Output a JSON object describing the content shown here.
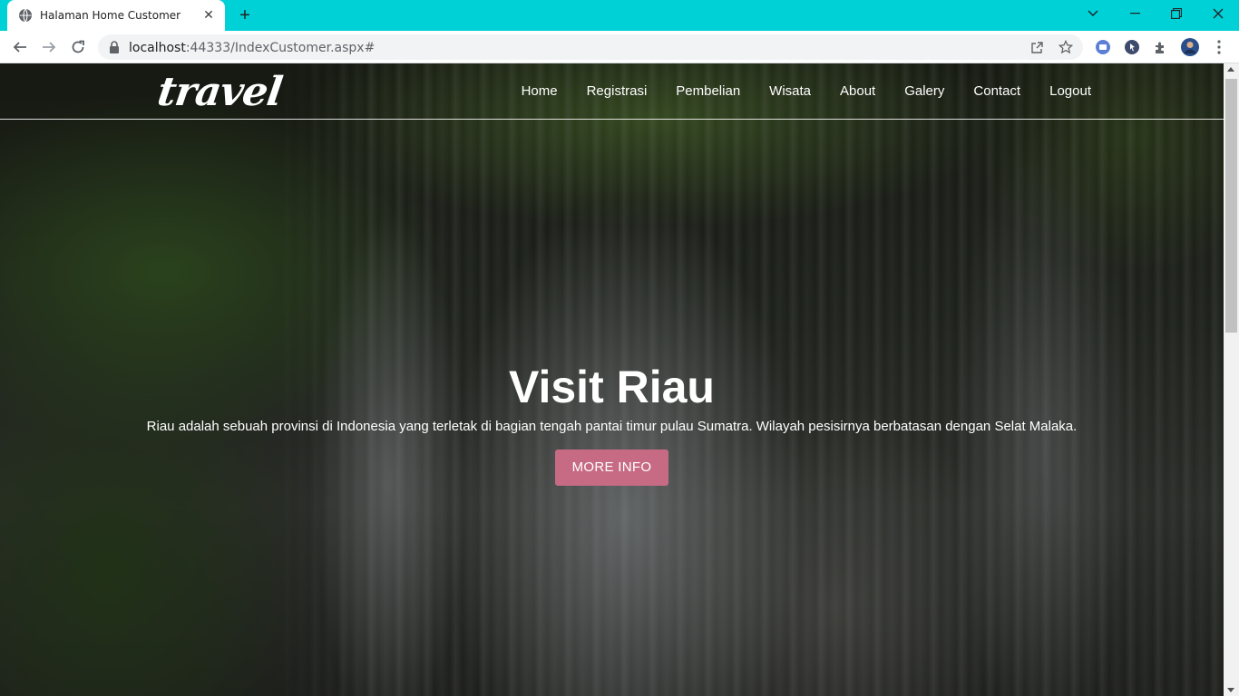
{
  "browser": {
    "tab_title": "Halaman Home Customer",
    "url_host": "localhost",
    "url_rest": ":44333/IndexCustomer.aspx#",
    "tabbar_color": "#00d1d6"
  },
  "site": {
    "logo": "travel",
    "menu": [
      "Home",
      "Registrasi",
      "Pembelian",
      "Wisata",
      "About",
      "Galery",
      "Contact",
      "Logout"
    ]
  },
  "hero": {
    "title": "Visit Riau",
    "description": "Riau adalah sebuah provinsi di Indonesia yang terletak di bagian tengah pantai timur pulau Sumatra. Wilayah pesisirnya berbatasan dengan Selat Malaka.",
    "button": "MORE INFO",
    "button_color": "#c76b85"
  }
}
